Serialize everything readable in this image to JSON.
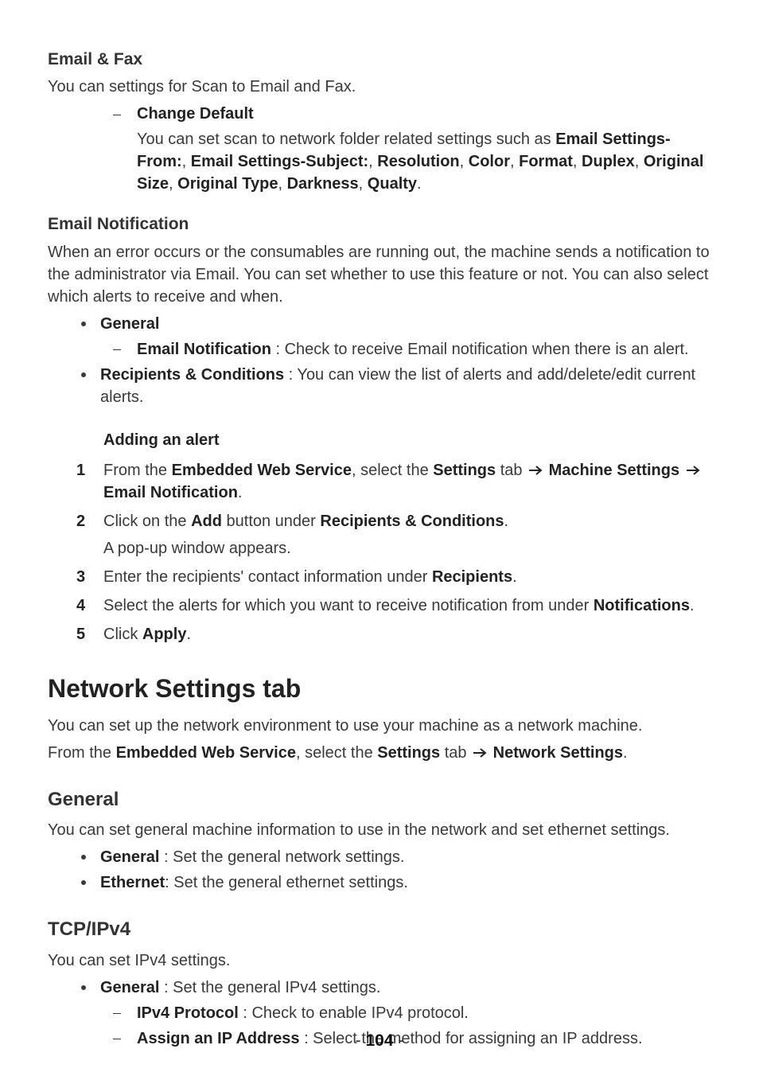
{
  "emailFax": {
    "heading": "Email & Fax",
    "intro": "You can settings for Scan to Email and Fax.",
    "dash1": {
      "title": "Change Default",
      "body_pre": "You can set scan to network folder related settings such as ",
      "b1": "Email Settings-From:",
      "sep1": ", ",
      "b2": "Email Settings-Subject:",
      "sep2": ", ",
      "b3": "Resolution",
      "sep3": ", ",
      "b4": "Color",
      "sep4": ", ",
      "b5": "Format",
      "sep5": ", ",
      "b6": "Duplex",
      "sep6": ", ",
      "b7": "Original Size",
      "sep7": ", ",
      "b8": "Original Type",
      "sep8": ", ",
      "b9": "Darkness",
      "sep9": ", ",
      "b10": "Qualty",
      "sep10": "."
    }
  },
  "emailNotif": {
    "heading": "Email Notification",
    "intro": "When an error occurs or the consumables are running out, the machine sends a notification to the administrator via Email. You can set whether to use this feature or not. You can also select which alerts to receive and when.",
    "bullet1Title": "General",
    "bullet1dashTitle": "Email Notification",
    "bullet1dashRest": " : Check to receive Email notification when there is an alert.",
    "bullet2Title": "Recipients & Conditions",
    "bullet2Rest": " : You can view the list of alerts and add/delete/edit current alerts.",
    "addingHeading": "Adding an alert",
    "step1": {
      "num": "1",
      "pre": "From the ",
      "b1": "Embedded Web Service",
      "mid1": ", select the ",
      "b2": "Settings",
      "mid2": " tab ",
      "b3": "Machine Settings",
      "b4": "Email Notification",
      "end": "."
    },
    "step2": {
      "num": "2",
      "pre": "Click on the ",
      "b1": "Add",
      "mid1": " button under ",
      "b2": "Recipients & Conditions",
      "end": ".",
      "sub": "A pop-up window appears."
    },
    "step3": {
      "num": "3",
      "pre": "Enter the recipients' contact information under ",
      "b1": "Recipients",
      "end": "."
    },
    "step4": {
      "num": "4",
      "pre": "Select the alerts for which you want to receive notification from under ",
      "b1": "Notifications",
      "end": "."
    },
    "step5": {
      "num": "5",
      "pre": "Click ",
      "b1": "Apply",
      "end": "."
    }
  },
  "network": {
    "heading": "Network Settings tab",
    "intro1": "You can set up the network environment to use your machine as a network machine.",
    "intro2pre": "From the ",
    "intro2b1": "Embedded Web Service",
    "intro2mid": ", select the ",
    "intro2b2": "Settings",
    "intro2mid2": " tab ",
    "intro2b3": "Network Settings",
    "intro2end": "."
  },
  "general": {
    "heading": "General",
    "intro": "You can set general machine information to use in the network and set ethernet settings.",
    "bullet1Title": "General",
    "bullet1Rest": " : Set the general network settings.",
    "bullet2Title": "Ethernet",
    "bullet2Rest": ": Set the general ethernet settings."
  },
  "tcpip": {
    "heading": "TCP/IPv4",
    "intro": "You can set IPv4 settings.",
    "bullet1Title": "General",
    "bullet1Rest": " : Set the general IPv4 settings.",
    "dash1Title": "IPv4 Protocol",
    "dash1Rest": " : Check to enable IPv4 protocol.",
    "dash2Title": "Assign an IP Address",
    "dash2Rest": " : Select the method for assigning an IP address."
  },
  "footer": {
    "dash": "- ",
    "page": "104",
    "trail": " -"
  },
  "arrowSpace": " "
}
